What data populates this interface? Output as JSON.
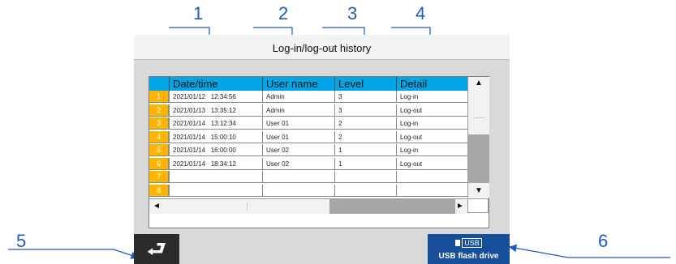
{
  "callouts": [
    "1",
    "2",
    "3",
    "4",
    "5",
    "6"
  ],
  "screen": {
    "title": "Log-in/log-out history",
    "columns": {
      "date_time": "Date/time",
      "user_name": "User name",
      "level": "Level",
      "detail": "Detail"
    },
    "rows": [
      {
        "num": "1",
        "date": "2021/01/12   12:34:56",
        "user": "Admin",
        "level": "3",
        "detail": "Log-in"
      },
      {
        "num": "2",
        "date": "2021/01/13   13:35:12",
        "user": "Admin",
        "level": "3",
        "detail": "Log-out"
      },
      {
        "num": "3",
        "date": "2021/01/14   13:12:34",
        "user": "User 01",
        "level": "2",
        "detail": "Log-in"
      },
      {
        "num": "4",
        "date": "2021/01/14   15:00:10",
        "user": "User 01",
        "level": "2",
        "detail": "Log-out"
      },
      {
        "num": "5",
        "date": "2021/01/14   16:00:00",
        "user": "User 02",
        "level": "1",
        "detail": "Log-in"
      },
      {
        "num": "6",
        "date": "2021/01/14   18:34:12",
        "user": "User 02",
        "level": "1",
        "detail": "Log-out"
      },
      {
        "num": "7",
        "date": "",
        "user": "",
        "level": "",
        "detail": ""
      },
      {
        "num": "8",
        "date": "",
        "user": "",
        "level": "",
        "detail": ""
      }
    ],
    "back_icon": "return-arrow-icon",
    "usb": {
      "icon_label": "USB",
      "label": "USB flash drive"
    }
  },
  "colors": {
    "header": "#00a6e8",
    "row_number": "#ffb400",
    "usb_button": "#174f9b",
    "back_button": "#2b2b2b",
    "callout": "#1f57c8"
  }
}
